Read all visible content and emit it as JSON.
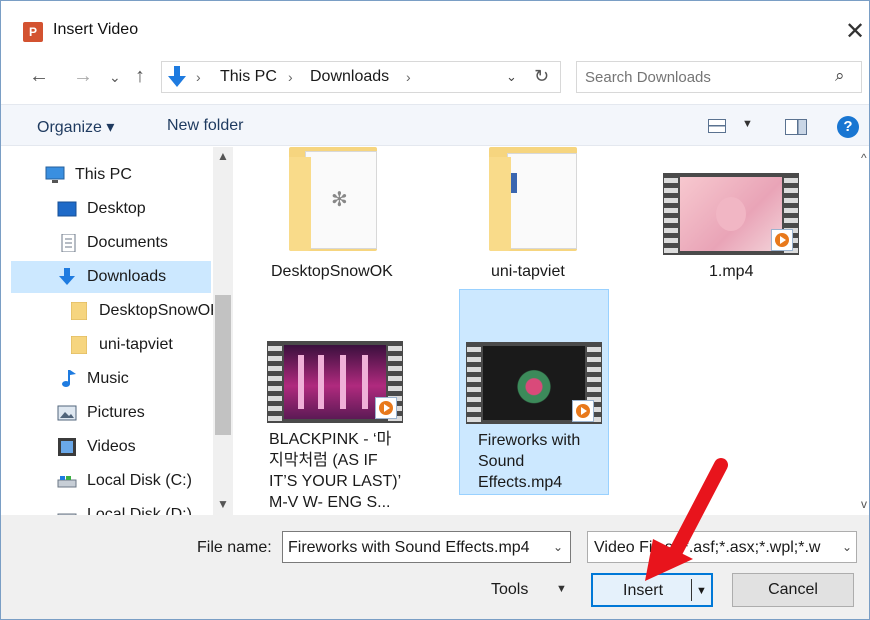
{
  "window": {
    "title": "Insert Video",
    "app_icon": "powerpoint-icon",
    "close_glyph": "✕"
  },
  "nav_buttons": {
    "back": "←",
    "forward": "→",
    "recent": "⌄",
    "up": "↑"
  },
  "address": {
    "crumbs": [
      "This PC",
      "Downloads"
    ],
    "separator": "›",
    "dropdown": "⌄",
    "refresh": "↻"
  },
  "search": {
    "placeholder": "Search Downloads",
    "icon": "⌕"
  },
  "toolbar": {
    "organize": "Organize ▾",
    "new_folder": "New folder",
    "view_dd": "▼",
    "help": "?"
  },
  "sidebar": {
    "items": [
      {
        "label": "This PC",
        "icon": "computer-icon"
      },
      {
        "label": "Desktop",
        "icon": "desktop-icon"
      },
      {
        "label": "Documents",
        "icon": "documents-icon"
      },
      {
        "label": "Downloads",
        "icon": "downloads-icon",
        "selected": true
      },
      {
        "label": "DesktopSnowOK",
        "icon": "folder-icon"
      },
      {
        "label": "uni-tapviet",
        "icon": "folder-icon"
      },
      {
        "label": "Music",
        "icon": "music-icon"
      },
      {
        "label": "Pictures",
        "icon": "pictures-icon"
      },
      {
        "label": "Videos",
        "icon": "videos-icon"
      },
      {
        "label": "Local Disk (C:)",
        "icon": "drive-icon"
      },
      {
        "label": "Local Disk (D:)",
        "icon": "drive-icon"
      }
    ],
    "scroll_up": "▲",
    "scroll_down": "▼"
  },
  "files": [
    {
      "name": "DesktopSnowOK",
      "type": "folder"
    },
    {
      "name": "uni-tapviet",
      "type": "folder"
    },
    {
      "name": "1.mp4",
      "type": "video"
    },
    {
      "name_lines": [
        "BLACKPINK - ‘마",
        "지막처럼 (AS IF",
        "IT’S YOUR LAST)’",
        "M-V W- ENG S..."
      ],
      "type": "video"
    },
    {
      "name_lines": [
        "Fireworks with",
        "Sound",
        "Effects.mp4"
      ],
      "type": "video",
      "selected": true
    }
  ],
  "files_scroll": {
    "up": "^",
    "down": "v"
  },
  "bottom": {
    "file_name_label": "File name:",
    "file_name_value": "Fireworks with Sound Effects.mp4",
    "file_type_value": "Video Files (*.asf;*.asx;*.wpl;*.w",
    "dropdown": "⌄",
    "tools": "Tools",
    "tools_dd": "▼",
    "insert": "Insert",
    "insert_dd": "▼",
    "cancel": "Cancel"
  },
  "colors": {
    "selection": "#cce8ff",
    "accent": "#0078d7",
    "annotation_arrow": "#e8141c"
  }
}
